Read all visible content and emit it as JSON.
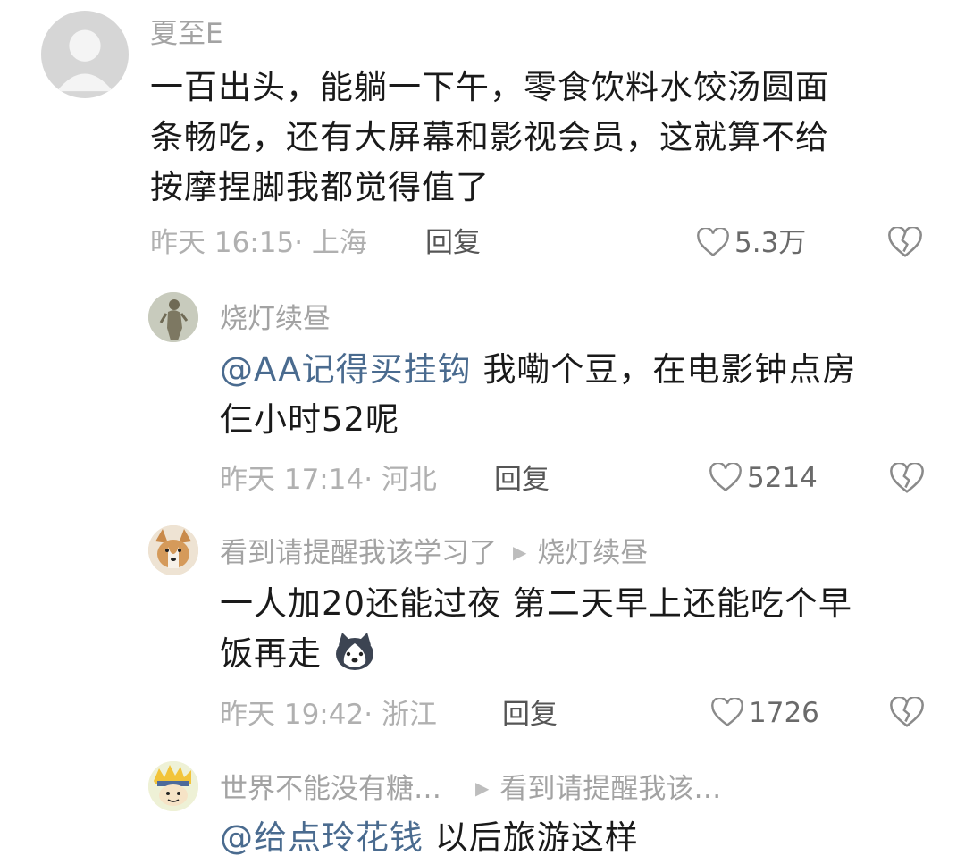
{
  "comments": [
    {
      "user": "夏至E",
      "lines": [
        "一百出头，能躺一下午，零食饮料水饺汤圆面",
        "条畅吃，还有大屏幕和影视会员，这就算不给",
        "按摩捏脚我都觉得值了"
      ],
      "time": "昨天 16:15· 上海",
      "reply": "回复",
      "likes": "5.3万"
    },
    {
      "user": "烧灯续昼",
      "mention": "@AA记得买挂钩",
      "lines": [
        " 我嘞个豆，在电影钟点房",
        "仨小时52呢"
      ],
      "time": "昨天 17:14· 河北",
      "reply": "回复",
      "likes": "5214"
    },
    {
      "user": "看到请提醒我该学习了",
      "reply_to": "烧灯续昼",
      "lines": [
        "一人加20还能过夜 第二天早上还能吃个早",
        "饭再走"
      ],
      "time": "昨天 19:42· 浙江",
      "reply": "回复",
      "likes": "1726"
    },
    {
      "user": "世界不能没有糖…",
      "reply_to": "看到请提醒我该…",
      "mention": "@给点玲花钱",
      "lines": [
        " 以后旅游这样"
      ]
    }
  ],
  "icons": {
    "heart": "heart-outline-icon",
    "dislike": "broken-heart-icon",
    "reply_arrow": "play-triangle-icon"
  },
  "colors": {
    "mention": "#4a6b8f",
    "meta": "#b0b0b0"
  }
}
